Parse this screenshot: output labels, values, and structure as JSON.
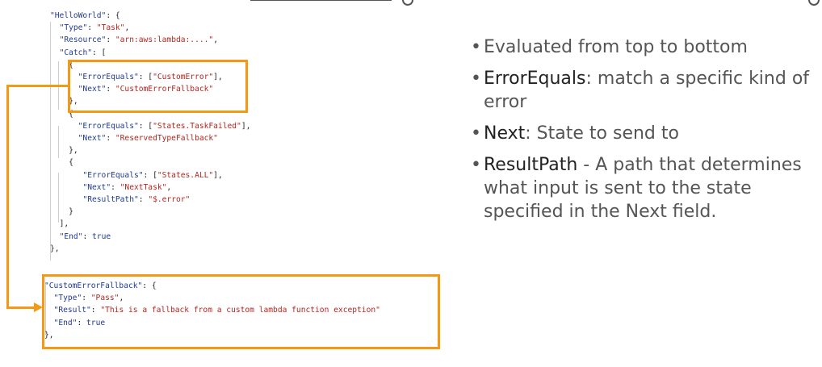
{
  "code": {
    "lines": [
      {
        "indent": "",
        "parts": [
          {
            "t": "\"HelloWorld\"",
            "c": "k"
          },
          {
            "t": ": {",
            "c": "p"
          }
        ]
      },
      {
        "indent": "  ",
        "parts": [
          {
            "t": "\"Type\"",
            "c": "k"
          },
          {
            "t": ": ",
            "c": "p"
          },
          {
            "t": "\"Task\"",
            "c": "s"
          },
          {
            "t": ",",
            "c": "p"
          }
        ]
      },
      {
        "indent": "  ",
        "parts": [
          {
            "t": "\"Resource\"",
            "c": "k"
          },
          {
            "t": ": ",
            "c": "p"
          },
          {
            "t": "\"arn:aws:lambda:....\"",
            "c": "s"
          },
          {
            "t": ",",
            "c": "p"
          }
        ]
      },
      {
        "indent": "  ",
        "parts": [
          {
            "t": "\"Catch\"",
            "c": "k"
          },
          {
            "t": ": [",
            "c": "p"
          }
        ]
      },
      {
        "indent": "    ",
        "parts": [
          {
            "t": "{",
            "c": "p"
          }
        ]
      },
      {
        "indent": "      ",
        "parts": [
          {
            "t": "\"ErrorEquals\"",
            "c": "k"
          },
          {
            "t": ": [",
            "c": "p"
          },
          {
            "t": "\"CustomError\"",
            "c": "s"
          },
          {
            "t": "],",
            "c": "p"
          }
        ]
      },
      {
        "indent": "      ",
        "parts": [
          {
            "t": "\"Next\"",
            "c": "k"
          },
          {
            "t": ": ",
            "c": "p"
          },
          {
            "t": "\"CustomErrorFallback\"",
            "c": "s"
          }
        ]
      },
      {
        "indent": "    ",
        "parts": [
          {
            "t": "},",
            "c": "p"
          }
        ]
      },
      {
        "indent": "    ",
        "parts": [
          {
            "t": "{",
            "c": "p"
          }
        ]
      },
      {
        "indent": "      ",
        "parts": [
          {
            "t": "\"ErrorEquals\"",
            "c": "k"
          },
          {
            "t": ": [",
            "c": "p"
          },
          {
            "t": "\"States.TaskFailed\"",
            "c": "s"
          },
          {
            "t": "],",
            "c": "p"
          }
        ]
      },
      {
        "indent": "      ",
        "parts": [
          {
            "t": "\"Next\"",
            "c": "k"
          },
          {
            "t": ": ",
            "c": "p"
          },
          {
            "t": "\"ReservedTypeFallback\"",
            "c": "s"
          }
        ]
      },
      {
        "indent": "    ",
        "parts": [
          {
            "t": "},",
            "c": "p"
          }
        ]
      },
      {
        "indent": "    ",
        "parts": [
          {
            "t": "{",
            "c": "p"
          }
        ]
      },
      {
        "indent": "       ",
        "parts": [
          {
            "t": "\"ErrorEquals\"",
            "c": "k"
          },
          {
            "t": ": [",
            "c": "p"
          },
          {
            "t": "\"States.ALL\"",
            "c": "s"
          },
          {
            "t": "],",
            "c": "p"
          }
        ]
      },
      {
        "indent": "       ",
        "parts": [
          {
            "t": "\"Next\"",
            "c": "k"
          },
          {
            "t": ": ",
            "c": "p"
          },
          {
            "t": "\"NextTask\"",
            "c": "s"
          },
          {
            "t": ",",
            "c": "p"
          }
        ]
      },
      {
        "indent": "       ",
        "parts": [
          {
            "t": "\"ResultPath\"",
            "c": "k"
          },
          {
            "t": ": ",
            "c": "p"
          },
          {
            "t": "\"$.error\"",
            "c": "s"
          }
        ]
      },
      {
        "indent": "    ",
        "parts": [
          {
            "t": "}",
            "c": "p"
          }
        ]
      },
      {
        "indent": "  ",
        "parts": [
          {
            "t": "],",
            "c": "p"
          }
        ]
      },
      {
        "indent": "  ",
        "parts": [
          {
            "t": "\"End\"",
            "c": "k"
          },
          {
            "t": ": ",
            "c": "p"
          },
          {
            "t": "true",
            "c": "b"
          }
        ]
      },
      {
        "indent": "",
        "parts": [
          {
            "t": "},",
            "c": "p"
          }
        ]
      },
      {
        "indent": "",
        "parts": [
          {
            "t": "\"CustomErrorFallback\"",
            "c": "k"
          },
          {
            "t": ": {",
            "c": "p"
          }
        ]
      },
      {
        "indent": "  ",
        "parts": [
          {
            "t": "\"Type\"",
            "c": "k"
          },
          {
            "t": ": ",
            "c": "p"
          },
          {
            "t": "\"Pass\"",
            "c": "s"
          },
          {
            "t": ",",
            "c": "p"
          }
        ]
      },
      {
        "indent": "  ",
        "parts": [
          {
            "t": "\"Result\"",
            "c": "k"
          },
          {
            "t": ": ",
            "c": "p"
          },
          {
            "t": "\"This is a fallback from a custom lambda function exception\"",
            "c": "s"
          }
        ]
      },
      {
        "indent": "  ",
        "parts": [
          {
            "t": "\"End\"",
            "c": "k"
          },
          {
            "t": ": ",
            "c": "p"
          },
          {
            "t": "true",
            "c": "b"
          }
        ]
      },
      {
        "indent": "",
        "parts": [
          {
            "t": "},",
            "c": "p"
          }
        ]
      }
    ]
  },
  "bullets": [
    {
      "term": "",
      "text": "Evaluated from top to bottom"
    },
    {
      "term": "ErrorEquals",
      "text": ": match a specific kind of error"
    },
    {
      "term": "Next",
      "text": ": State to send to"
    },
    {
      "term": "ResultPath",
      "text": " - A path that determines what input is sent to the state specified in the Next field."
    }
  ],
  "bullet_symbol": "•",
  "colors": {
    "key": "#1f3a93",
    "string": "#b3261e",
    "highlight": "#f29a15",
    "bullet_text": "#555555",
    "term_text": "#222222"
  }
}
